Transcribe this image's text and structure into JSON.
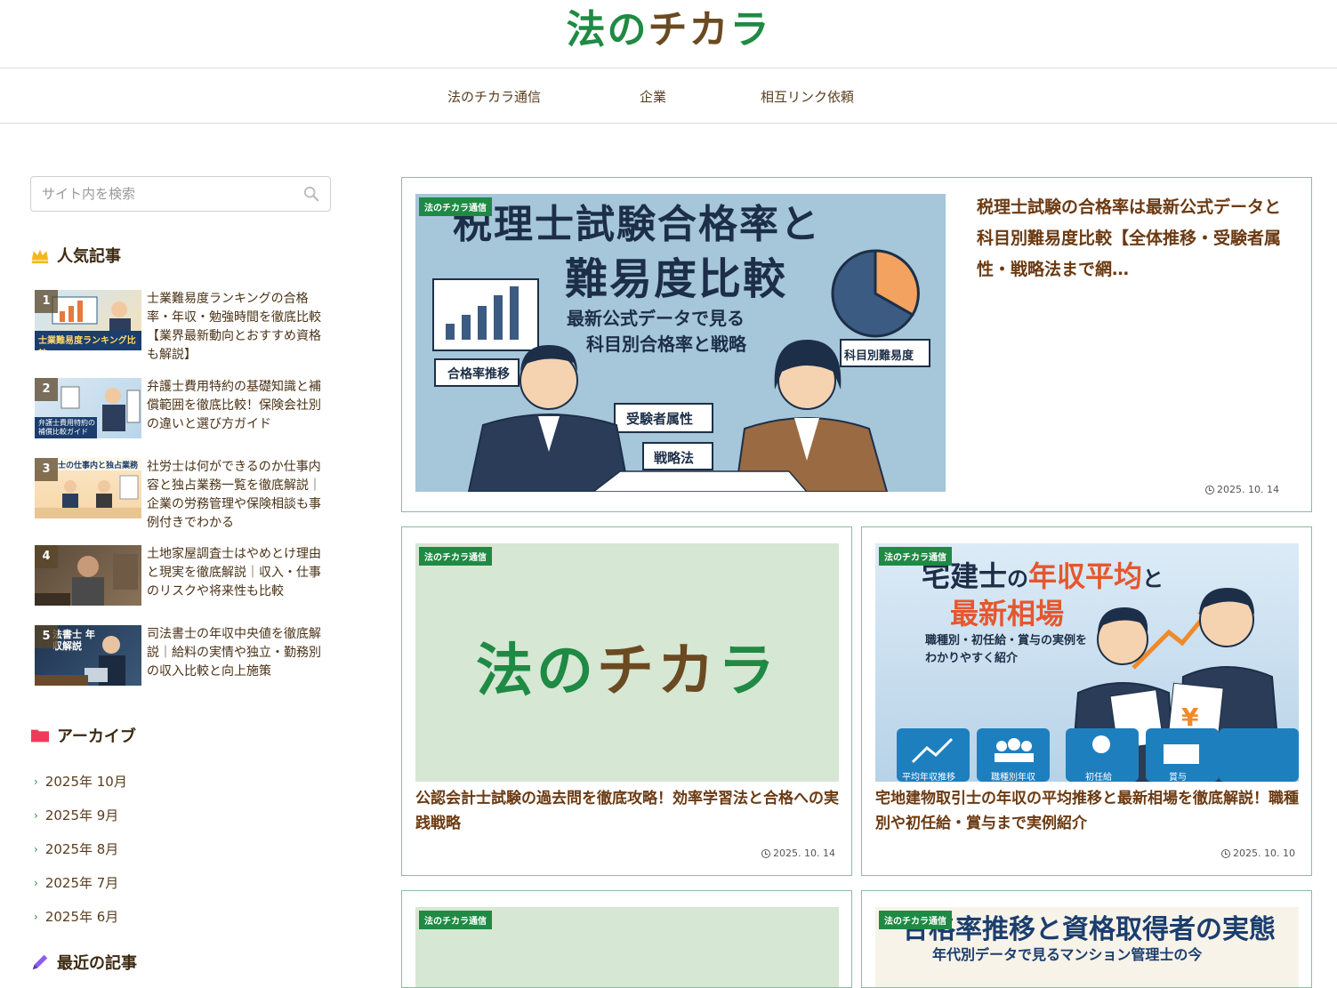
{
  "site": {
    "logo_green": "法の",
    "logo_brown": "チカ",
    "logo_green2": "ラ"
  },
  "nav": [
    "法のチカラ通信",
    "企業",
    "相互リンク依頼"
  ],
  "search": {
    "placeholder": "サイト内を検索"
  },
  "popular": {
    "title": "人気記事",
    "items": [
      {
        "rank": "1",
        "title": "士業難易度ランキングの合格率・年収・勉強時間を徹底比較【業界最新動向とおすすめ資格も解説】",
        "thumb_text": "士業難易度ランキング比較"
      },
      {
        "rank": "2",
        "title": "弁護士費用特約の基礎知識と補償範囲を徹底比較！保険会社別の違いと選び方ガイド",
        "thumb_text": "弁護士費用特約の補償比較ガイド"
      },
      {
        "rank": "3",
        "title": "社労士は何ができるのか仕事内容と独占業務一覧を徹底解説｜企業の労務管理や保険相談も事例付きでわかる",
        "thumb_text": "士の仕事内と独占業務"
      },
      {
        "rank": "4",
        "title": "土地家屋調査士はやめとけ理由と現実を徹底解説｜収入・仕事のリスクや将来性も比較",
        "thumb_text": ""
      },
      {
        "rank": "5",
        "title": "司法書士の年収中央値を徹底解説｜給料の実情や独立・勤務別の収入比較と向上施策",
        "thumb_text": "法書士 年収解説"
      }
    ]
  },
  "archive": {
    "title": "アーカイブ",
    "items": [
      "2025年 10月",
      "2025年 9月",
      "2025年 8月",
      "2025年 7月",
      "2025年 6月"
    ]
  },
  "recent": {
    "title": "最近の記事"
  },
  "articles": [
    {
      "category": "法のチカラ通信",
      "title": "税理士試験の合格率は最新公式データと科目別難易度比較【全体推移・受験者属性・戦略法まで網…",
      "date": "2025. 10. 14",
      "thumb": {
        "line1": "税理士試験合格率と",
        "line2": "難易度比較",
        "line3": "最新公式データで見る",
        "line4": "科目別合格率と戦略",
        "label_a": "合格率推移",
        "label_b": "受験者属性",
        "label_c": "戦略法",
        "label_d": "科目別難易度"
      }
    },
    {
      "category": "法のチカラ通信",
      "title": "公認会計士試験の過去問を徹底攻略！効率学習法と合格への実践戦略",
      "date": "2025. 10. 14"
    },
    {
      "category": "法のチカラ通信",
      "title": "宅地建物取引士の年収の平均推移と最新相場を徹底解説！職種別や初任給・賞与まで実例紹介",
      "date": "2025. 10. 10",
      "thumb": {
        "line1a": "宅建士",
        "line1b": "の",
        "line1c": "年収平均",
        "line1d": "と",
        "line2": "最新相場",
        "line3": "職種別・初任給・賞与の実例を",
        "line4": "わかりやすく紹介",
        "icons": [
          "平均年収推移",
          "職種別年収",
          "初任給",
          "賞与"
        ]
      }
    },
    {
      "category": "法のチカラ通信"
    },
    {
      "category": "法のチカラ通信",
      "thumb": {
        "line1": "合格率推移と資格取得者の実態",
        "line2": "年代別データで見るマンション管理士の今"
      }
    }
  ],
  "colors": {
    "accent_green": "#1f8a44",
    "title_brown": "#6b3a12",
    "card_border": "#8fb9a6"
  }
}
